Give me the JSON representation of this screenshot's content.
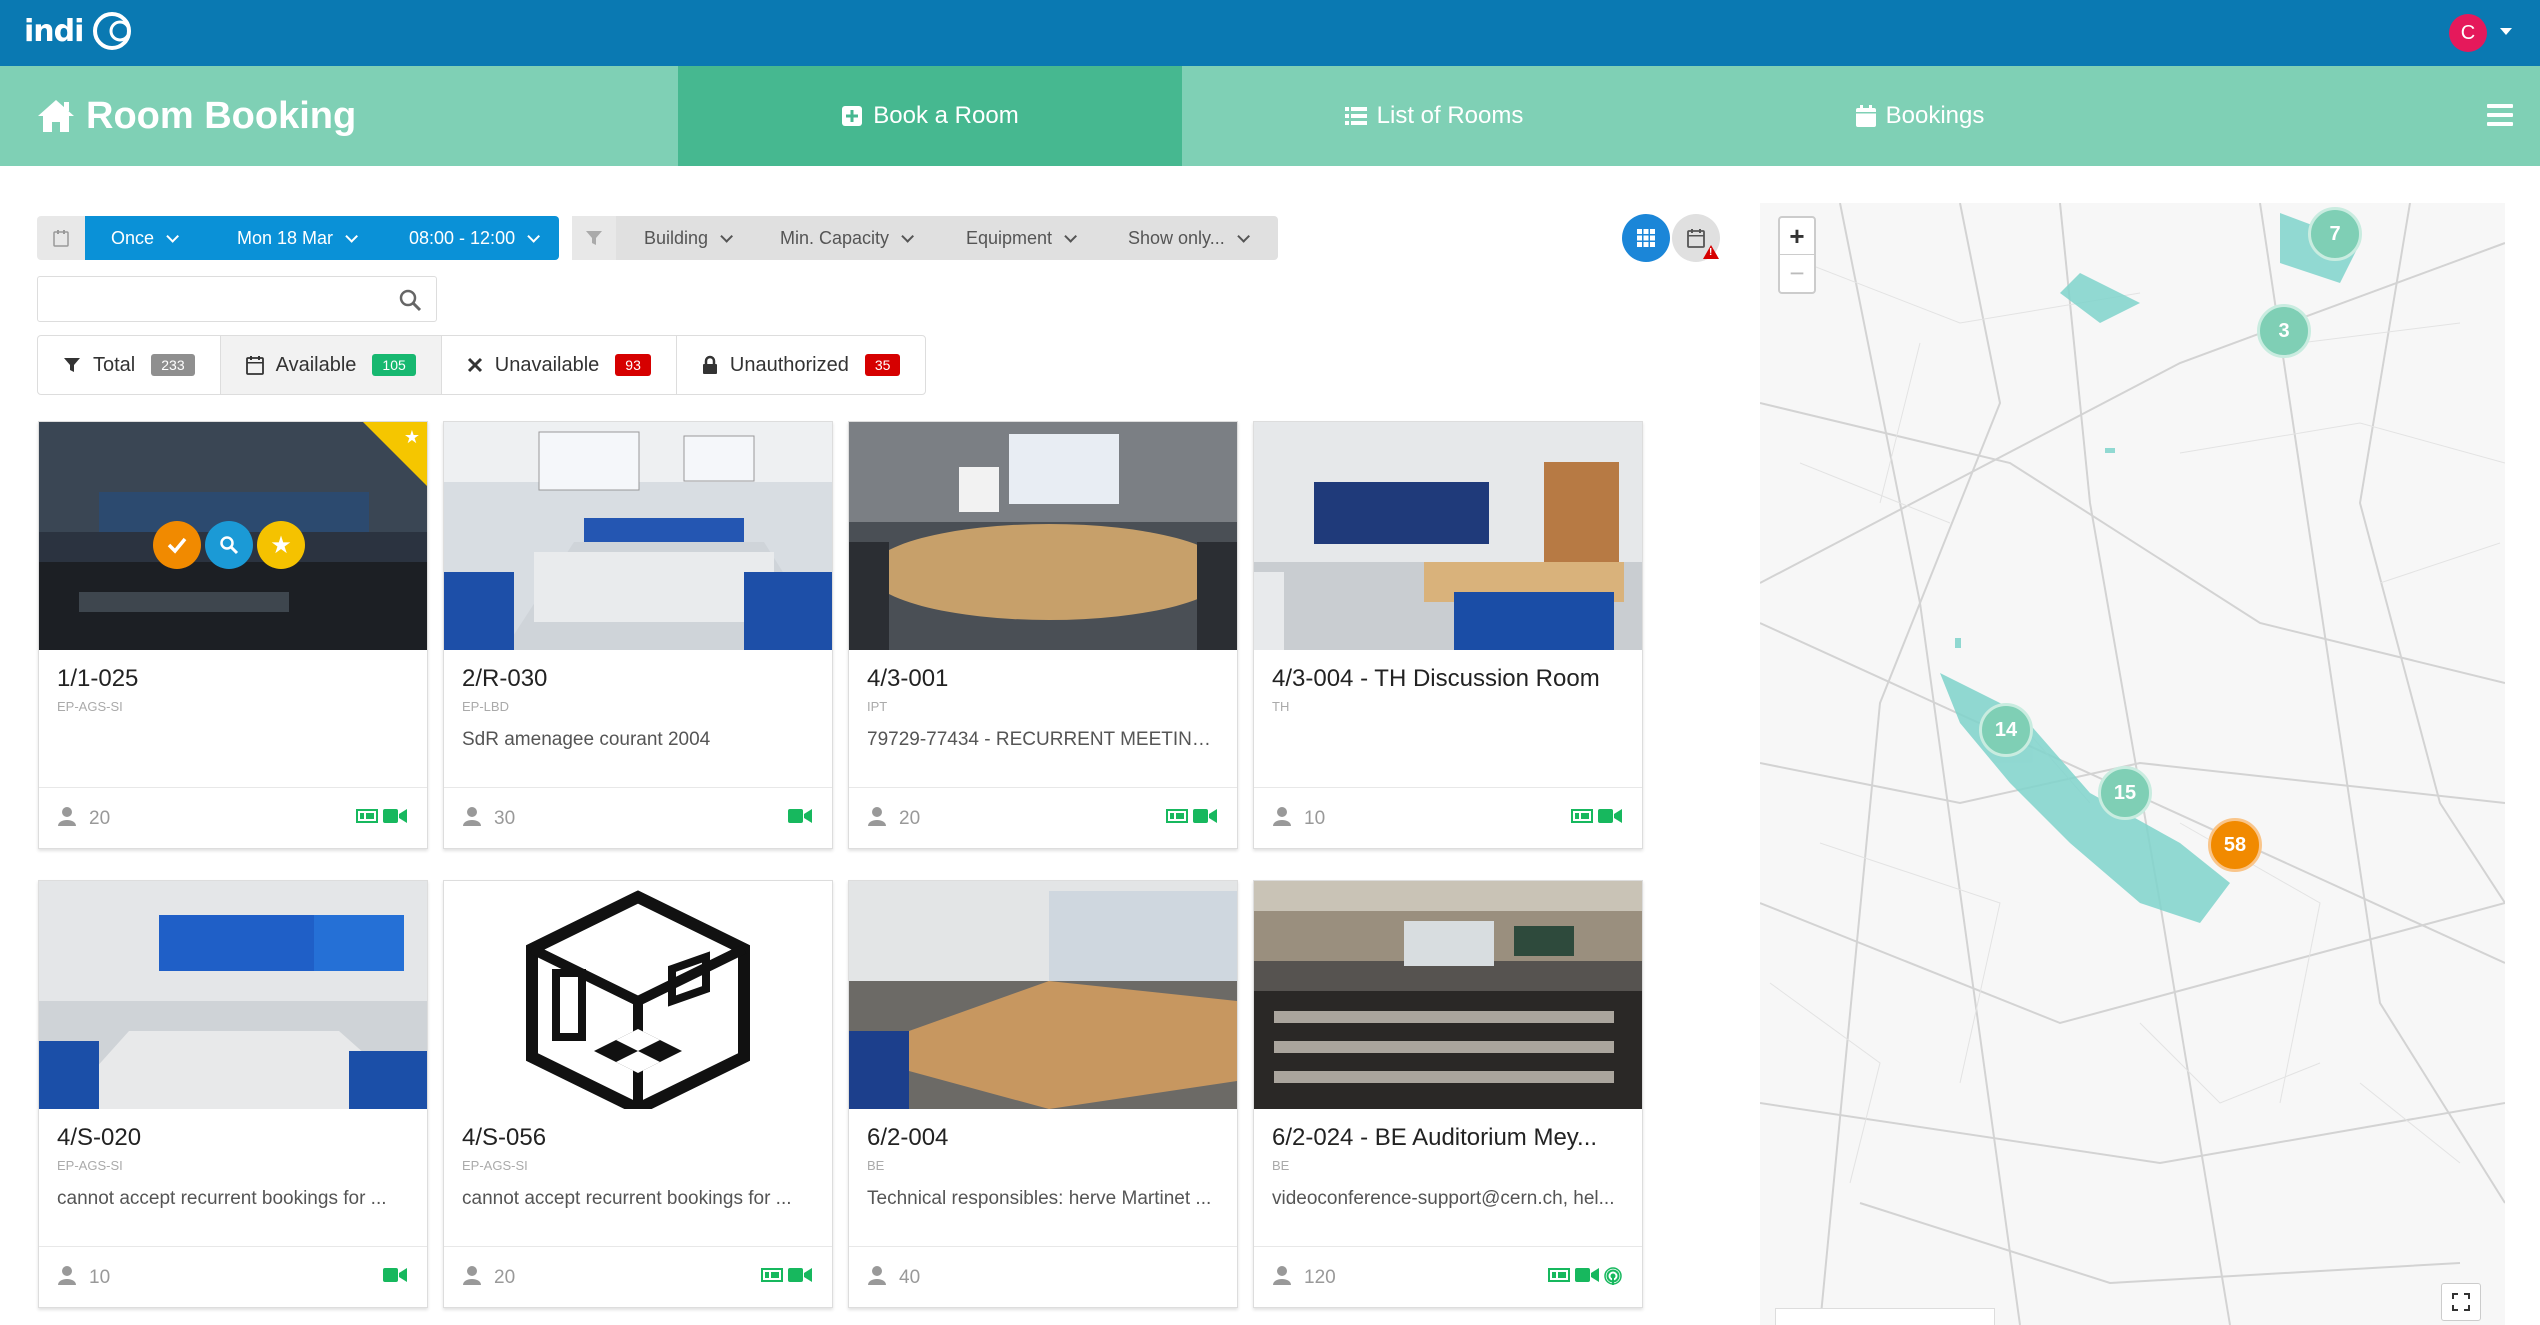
{
  "app": {
    "logo_text": "indico",
    "user_initial": "C"
  },
  "module": {
    "title": "Room Booking"
  },
  "nav": {
    "book_a_room": "Book a Room",
    "list_of_rooms": "List of Rooms",
    "bookings": "Bookings"
  },
  "datebar": {
    "recurrence": "Once",
    "date": "Mon 18 Mar",
    "time": "08:00 - 12:00"
  },
  "filters": {
    "building": "Building",
    "min_capacity": "Min. Capacity",
    "equipment": "Equipment",
    "show_only": "Show only..."
  },
  "search": {
    "value": "",
    "placeholder": ""
  },
  "stats": {
    "total_label": "Total",
    "total_count": "233",
    "available_label": "Available",
    "available_count": "105",
    "unavailable_label": "Unavailable",
    "unavailable_count": "93",
    "unauthorized_label": "Unauthorized",
    "unauthorized_count": "35"
  },
  "colors": {
    "topbar": "#0a79b2",
    "module": "#7fd0b5",
    "active_tab": "#46b890",
    "accent_blue": "#0a91d7",
    "green": "#17b85e",
    "red": "#d60000",
    "grey_badge": "#8f8f8f"
  },
  "rooms": [
    {
      "name": "1/1-025",
      "division": "EP-AGS-SI",
      "comment": "",
      "capacity": "20",
      "equipment": [
        "projector-icon",
        "videoconference-icon"
      ],
      "favorite": true
    },
    {
      "name": "2/R-030",
      "division": "EP-LBD",
      "comment": "SdR amenagee courant 2004",
      "capacity": "30",
      "equipment": [
        "videoconference-icon"
      ]
    },
    {
      "name": "4/3-001",
      "division": "IPT",
      "comment": "79729-77434 - RECURRENT MEETING...",
      "capacity": "20",
      "equipment": [
        "projector-icon",
        "videoconference-icon"
      ]
    },
    {
      "name": "4/3-004 - TH Discussion Room",
      "division": "TH",
      "comment": "",
      "capacity": "10",
      "equipment": [
        "projector-icon",
        "videoconference-icon"
      ]
    },
    {
      "name": "4/S-020",
      "division": "EP-AGS-SI",
      "comment": "cannot accept recurrent bookings for ...",
      "capacity": "10",
      "equipment": [
        "videoconference-icon"
      ]
    },
    {
      "name": "4/S-056",
      "division": "EP-AGS-SI",
      "comment": "cannot accept recurrent bookings for ...",
      "capacity": "20",
      "equipment": [
        "projector-icon",
        "videoconference-icon"
      ]
    },
    {
      "name": "6/2-004",
      "division": "BE",
      "comment": "Technical responsibles: herve Martinet ...",
      "capacity": "40",
      "equipment": []
    },
    {
      "name": "6/2-024 - BE Auditorium Mey...",
      "division": "BE",
      "comment": "videoconference-support@cern.ch, hel...",
      "capacity": "120",
      "equipment": [
        "projector-icon",
        "videoconference-icon",
        "webcast-icon"
      ]
    }
  ],
  "map": {
    "zoom_in": "+",
    "zoom_out": "−",
    "clusters": [
      "7",
      "3",
      "14",
      "15",
      "58"
    ]
  }
}
